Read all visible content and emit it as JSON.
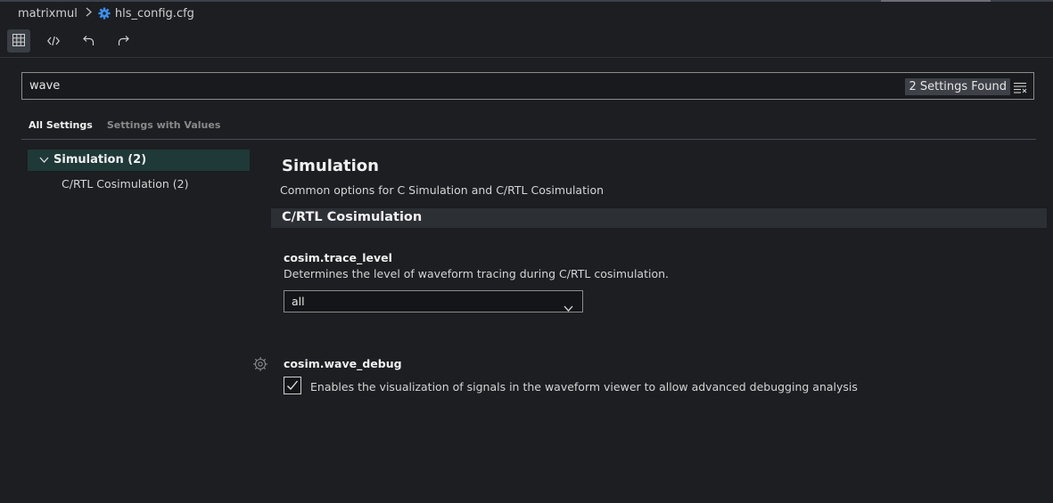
{
  "breadcrumb": {
    "project": "matrixmul",
    "file": "hls_config.cfg"
  },
  "toolbar": {
    "items": [
      "table-view-icon",
      "code-view-icon",
      "undo-icon",
      "redo-icon"
    ]
  },
  "search": {
    "value": "wave",
    "results_badge": "2 Settings Found"
  },
  "tabs": [
    "All Settings",
    "Settings with Values"
  ],
  "tree": {
    "items": [
      {
        "label": "Simulation (2)",
        "expanded": true,
        "selected": true
      },
      {
        "label": "C/RTL Cosimulation (2)"
      }
    ]
  },
  "section": {
    "title": "Simulation",
    "description": "Common options for C Simulation and C/RTL Cosimulation",
    "subsection": "C/RTL Cosimulation"
  },
  "settings": [
    {
      "name": "cosim.trace_level",
      "description": "Determines the level of waveform tracing during C/RTL cosimulation.",
      "value": "all"
    },
    {
      "name": "cosim.wave_debug",
      "description": "Enables the visualization of signals in the waveform viewer to allow advanced debugging analysis",
      "checked": true
    }
  ],
  "colors": {
    "accent": "#3b8eea",
    "tree_selection": "#1f3838",
    "background": "#1c1e22"
  }
}
